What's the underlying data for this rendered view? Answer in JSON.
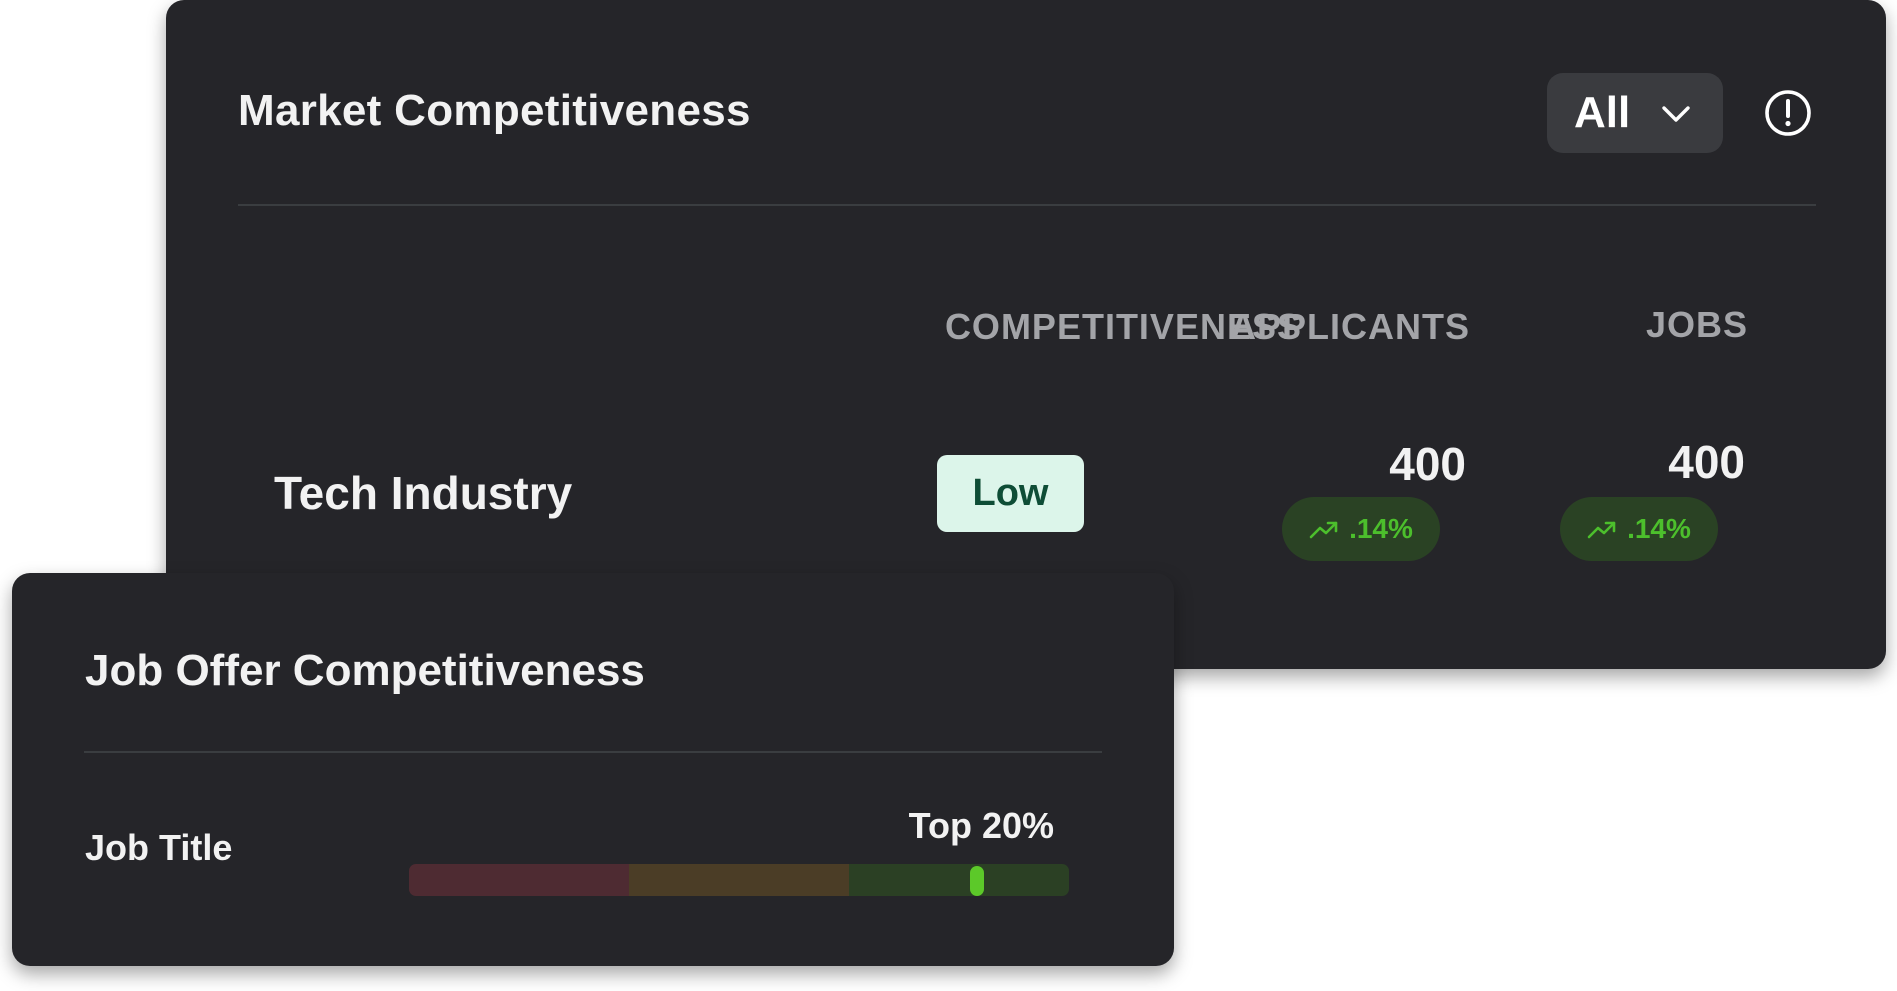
{
  "market": {
    "title": "Market Competitiveness",
    "filter": {
      "selected": "All",
      "icon": "chevron-down-icon"
    },
    "info_icon": "info-circle-icon",
    "columns": {
      "competitiveness": "COMPETITIVENESS",
      "applicants": "APPLICANTS",
      "jobs": "JOBS"
    },
    "rows": [
      {
        "label": "Tech Industry",
        "competitiveness": "Low",
        "applicants": {
          "value": "400",
          "trend": ".14%",
          "trend_icon": "trending-up-icon"
        },
        "jobs": {
          "value": "400",
          "trend": ".14%",
          "trend_icon": "trending-up-icon"
        }
      }
    ]
  },
  "offer": {
    "title": "Job Offer Competitiveness",
    "row_label": "Job Title",
    "rank": "Top 20%",
    "scale_position": 0.86
  },
  "colors": {
    "card_bg": "#252529",
    "low_badge_bg": "#dcf5ea",
    "low_badge_text": "#0e4d36",
    "trend_green": "#4cbf2c",
    "trend_pill_bg": "#2a4224",
    "scale_low": "#4e2b32",
    "scale_mid": "#4b3d26",
    "scale_high": "#2b4024",
    "marker": "#5cc929"
  }
}
